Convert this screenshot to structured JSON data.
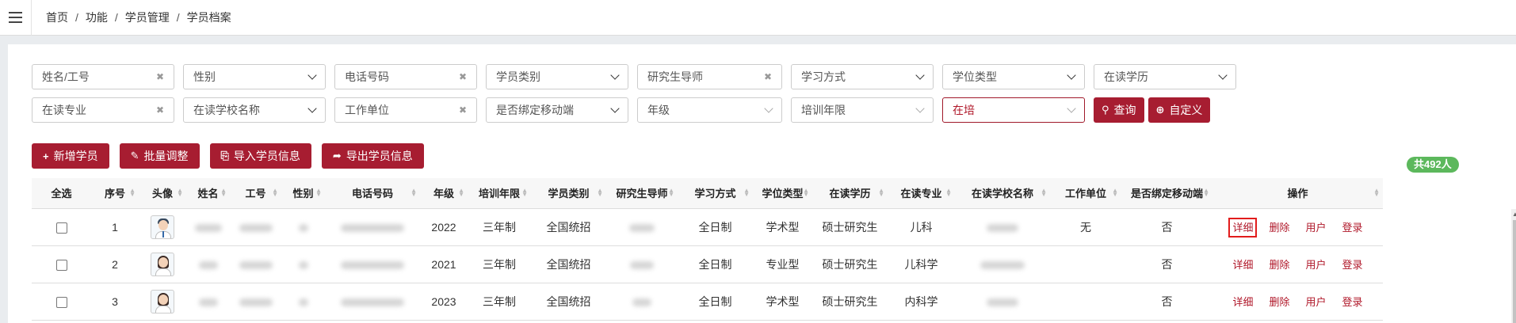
{
  "breadcrumb": {
    "items": [
      "首页",
      "功能",
      "学员管理",
      "学员档案"
    ],
    "sep": "/"
  },
  "filters": {
    "row1": [
      {
        "name": "name-or-id-input",
        "value": "姓名/工号",
        "kind": "text"
      },
      {
        "name": "gender-select",
        "value": "性别",
        "kind": "select"
      },
      {
        "name": "phone-input",
        "value": "电话号码",
        "kind": "text"
      },
      {
        "name": "student-type-select",
        "value": "学员类别",
        "kind": "select"
      },
      {
        "name": "supervisor-input",
        "value": "研究生导师",
        "kind": "text"
      },
      {
        "name": "study-mode-select",
        "value": "学习方式",
        "kind": "select"
      },
      {
        "name": "degree-type-select",
        "value": "学位类型",
        "kind": "select"
      },
      {
        "name": "education-select",
        "value": "在读学历",
        "kind": "select"
      }
    ],
    "row2": [
      {
        "name": "major-input",
        "value": "在读专业",
        "kind": "text"
      },
      {
        "name": "school-select",
        "value": "在读学校名称",
        "kind": "select"
      },
      {
        "name": "work-unit-input",
        "value": "工作单位",
        "kind": "text"
      },
      {
        "name": "mobile-bind-select",
        "value": "是否绑定移动端",
        "kind": "select"
      },
      {
        "name": "grade-select",
        "value": "年级",
        "kind": "select-light"
      },
      {
        "name": "training-years-select",
        "value": "培训年限",
        "kind": "select-light"
      },
      {
        "name": "status-select",
        "value": "在培",
        "kind": "select-red"
      }
    ],
    "query_label": "查询",
    "custom_label": "自定义"
  },
  "toolbar": {
    "add_label": "新增学员",
    "batch_label": "批量调整",
    "import_label": "导入学员信息",
    "export_label": "导出学员信息"
  },
  "total_label": "共492人",
  "table": {
    "headers": [
      "全选",
      "序号",
      "头像",
      "姓名",
      "工号",
      "性别",
      "电话号码",
      "年级",
      "培训年限",
      "学员类别",
      "研究生导师",
      "学习方式",
      "学位类型",
      "在读学历",
      "在读专业",
      "在读学校名称",
      "工作单位",
      "是否绑定移动端",
      "操作"
    ],
    "rows": [
      {
        "no": "1",
        "avatar": "male",
        "grade": "2022",
        "years": "三年制",
        "type": "全国统招",
        "mode": "全日制",
        "degree": "学术型",
        "edu": "硕士研究生",
        "major": "儿科",
        "unit": "无",
        "bound": "否"
      },
      {
        "no": "2",
        "avatar": "female",
        "grade": "2021",
        "years": "三年制",
        "type": "全国统招",
        "mode": "全日制",
        "degree": "专业型",
        "edu": "硕士研究生",
        "major": "儿科学",
        "unit": "",
        "bound": "否"
      },
      {
        "no": "3",
        "avatar": "female",
        "grade": "2023",
        "years": "三年制",
        "type": "全国统招",
        "mode": "全日制",
        "degree": "学术型",
        "edu": "硕士研究生",
        "major": "内科学",
        "unit": "",
        "bound": "否"
      }
    ],
    "ops": {
      "detail": "详细",
      "delete": "删除",
      "user": "用户",
      "login": "登录"
    }
  },
  "colors": {
    "accent": "#a71d31",
    "badge": "#5cb85c",
    "highlight": "#e21c1c"
  },
  "icons": {
    "menu": "hamburger-icon",
    "search": "search-icon",
    "zoom": "zoom-icon",
    "add": "plus-icon",
    "edit": "edit-icon",
    "import": "file-import-icon",
    "export": "share-icon",
    "clear": "clear-icon",
    "sort": "sort-icon"
  }
}
